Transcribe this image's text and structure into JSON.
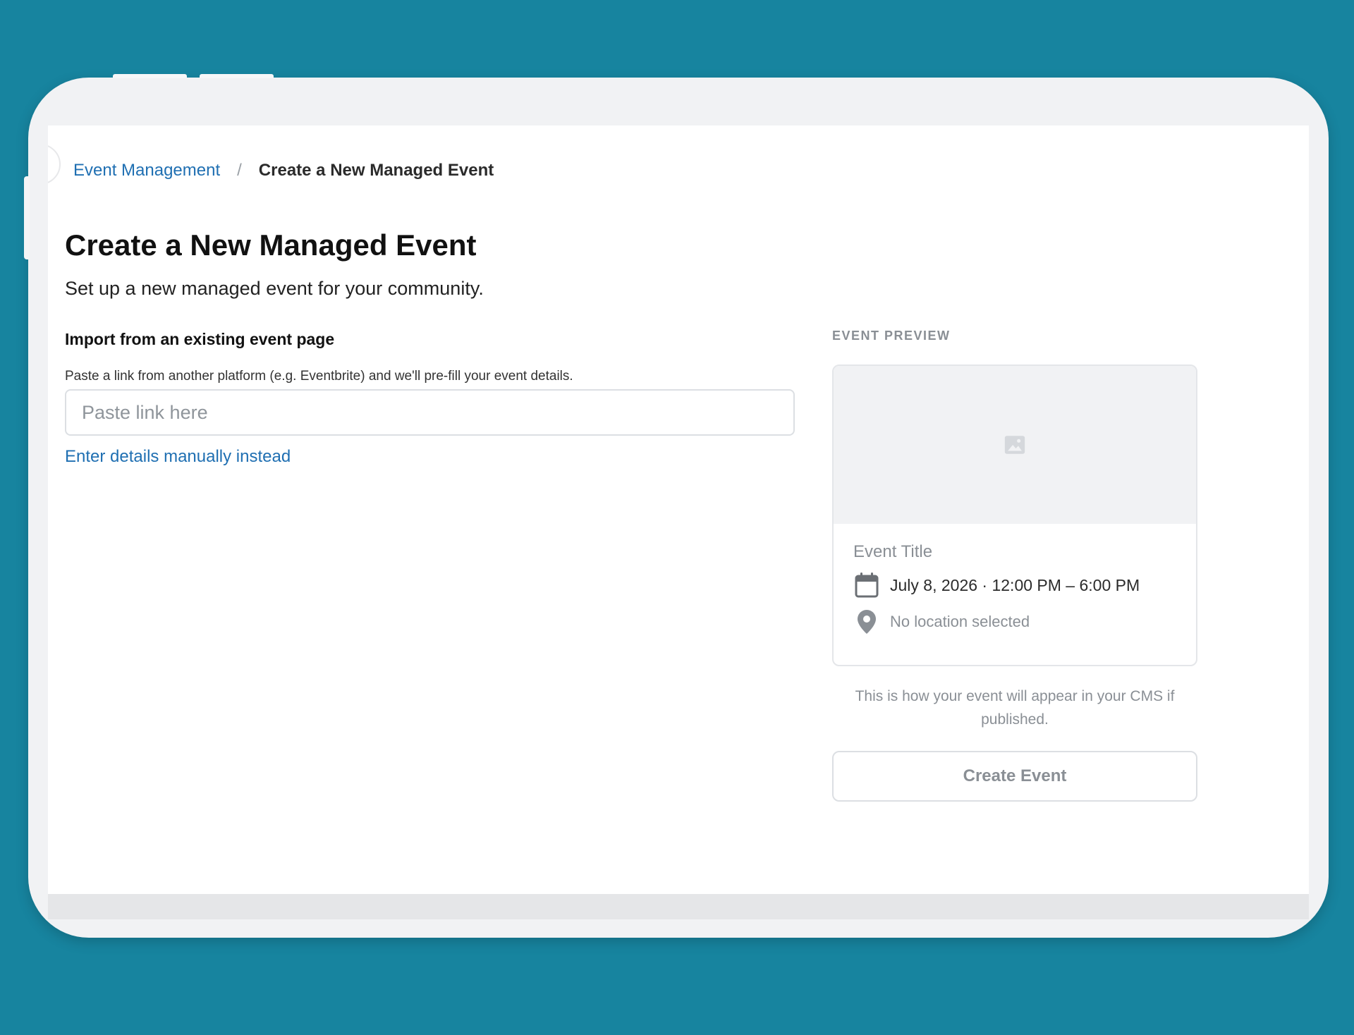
{
  "breadcrumb": {
    "parent_label": "Event Management",
    "separator": "/",
    "current_label": "Create a New Managed Event"
  },
  "page": {
    "title": "Create a New Managed Event",
    "subtitle": "Set up a new managed event for your community."
  },
  "import_section": {
    "title": "Import from an existing event page",
    "help_text": "Paste a link from another platform (e.g. Eventbrite) and we'll pre-fill your event details.",
    "input_value": "",
    "input_placeholder": "Paste link here",
    "manual_link_label": "Enter details manually instead"
  },
  "preview": {
    "section_label": "EVENT PREVIEW",
    "image_icon": "image-placeholder-icon",
    "event_title": "Event Title",
    "date_icon": "calendar-icon",
    "date_text": "July 8, 2026 · 12:00 PM – 6:00 PM",
    "location_icon": "map-pin-icon",
    "location_text": "No location selected",
    "note": "This is how your event will appear in your CMS if published."
  },
  "actions": {
    "create_label": "Create Event"
  },
  "colors": {
    "background": "#17849f",
    "link": "#1f6fb2",
    "muted": "#8a8f95"
  }
}
